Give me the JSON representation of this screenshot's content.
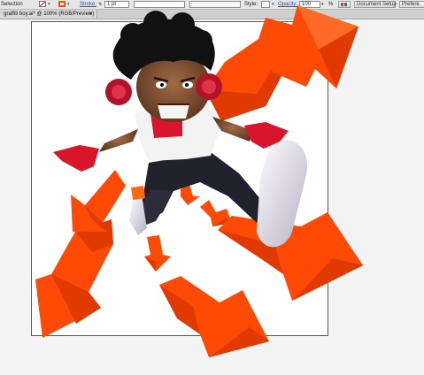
{
  "control_bar": {
    "selection_label": "Selection",
    "stroke_label": "Stroke:",
    "stroke_weight": "1 pt",
    "style_label": "Style:",
    "opacity_label": "Opacity:",
    "opacity_value": "100",
    "opacity_unit": "%",
    "document_setup_label": "Document Setup",
    "preferences_label": "Prefere",
    "dropdown_glyph": "▾",
    "stepper_glyph": "⇅"
  },
  "document_tab": {
    "title": "graffiti boy.ai* @ 100% (RGB/Preview)",
    "close_glyph": "✕"
  },
  "colors": {
    "arrow_orange": "#ff4a06",
    "arrow_shade": "#e13a00",
    "artboard": "#ffffff",
    "pasteboard": "#f4f4f4"
  },
  "icons": [
    "stroke-swatch-icon",
    "fill-swatch-icon",
    "stroke-stepper-icon",
    "style-dropdown-icon",
    "opacity-stepper-icon",
    "recolor-icon",
    "close-icon"
  ]
}
